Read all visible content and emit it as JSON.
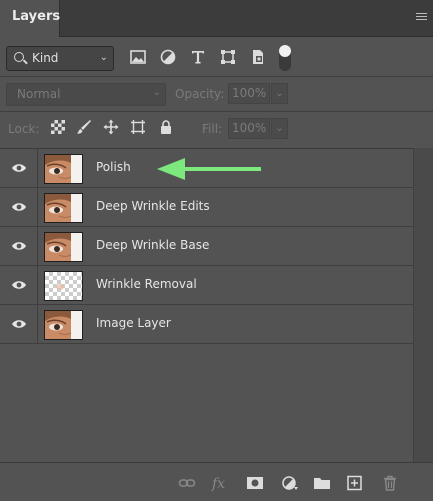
{
  "tabs": [
    {
      "label": "Layers"
    }
  ],
  "filter": {
    "kind_label": "Kind",
    "icons": [
      "image-filter-icon",
      "adjustment-filter-icon",
      "type-filter-icon",
      "shape-filter-icon",
      "smart-object-filter-icon"
    ]
  },
  "blend": {
    "mode": "Normal",
    "opacity_label": "Opacity:",
    "opacity_value": "100%"
  },
  "lock": {
    "label": "Lock:",
    "fill_label": "Fill:",
    "fill_value": "100%"
  },
  "layers": [
    {
      "name": "Polish",
      "thumb": "photo",
      "visible": true
    },
    {
      "name": "Deep Wrinkle Edits",
      "thumb": "photo",
      "visible": true
    },
    {
      "name": "Deep Wrinkle Base",
      "thumb": "photo",
      "visible": true
    },
    {
      "name": "Wrinkle Removal",
      "thumb": "transparent",
      "visible": true
    },
    {
      "name": "Image Layer",
      "thumb": "photo",
      "visible": true
    }
  ],
  "annotation": {
    "arrow_color": "#7de87d",
    "points_to": "Polish"
  },
  "footer_icons": [
    "link-icon",
    "fx-icon",
    "mask-icon",
    "adjustment-layer-icon",
    "folder-icon",
    "new-layer-icon",
    "trash-icon"
  ]
}
